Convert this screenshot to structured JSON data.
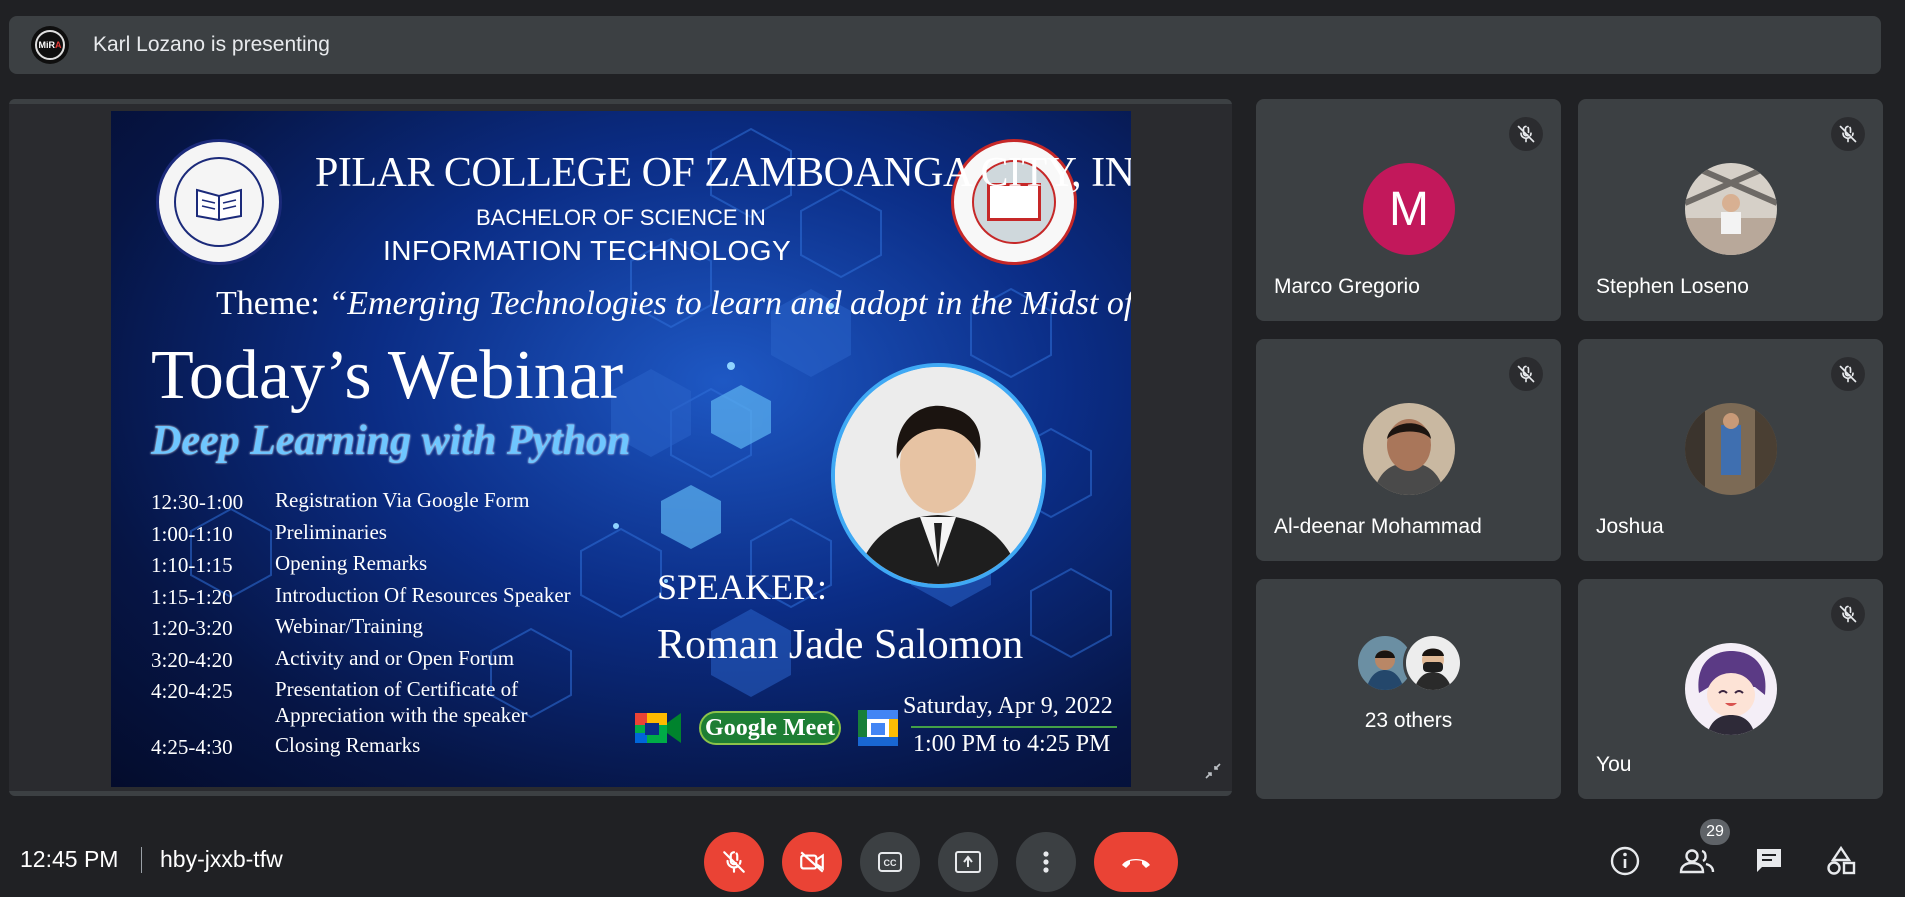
{
  "presenter_bar": {
    "avatar_text_main": "MiR",
    "avatar_text_accent": "A",
    "text": "Karl Lozano is presenting"
  },
  "slide": {
    "college": "PILAR COLLEGE OF ZAMBOANGA CITY, INC.",
    "degree_line1": "BACHELOR OF SCIENCE IN",
    "degree_line2": "INFORMATION TECHNOLOGY",
    "theme_label": "Theme:",
    "theme_text": "“Emerging Technologies to learn and adopt in the Midst of Pandemic”",
    "heading": "Today’s Webinar",
    "subheading": "Deep Learning with Python",
    "schedule": [
      {
        "time": "12:30-1:00",
        "activity": "Registration Via Google Form"
      },
      {
        "time": "1:00-1:10",
        "activity": "Preliminaries"
      },
      {
        "time": "1:10-1:15",
        "activity": "Opening Remarks"
      },
      {
        "time": "1:15-1:20",
        "activity": "Introduction Of Resources Speaker"
      },
      {
        "time": "1:20-3:20",
        "activity": "Webinar/Training"
      },
      {
        "time": "3:20-4:20",
        "activity": "Activity and or Open Forum"
      },
      {
        "time": "4:20-4:25",
        "activity": "Presentation of Certificate of Appreciation with the speaker"
      },
      {
        "time": "4:25-4:30",
        "activity": "Closing Remarks"
      }
    ],
    "speaker_label": "SPEAKER:",
    "speaker_name": "Roman Jade Salomon",
    "platform": "Google Meet",
    "date": "Saturday, Apr 9, 2022",
    "time": "1:00 PM to 4:25 PM"
  },
  "participants": [
    {
      "name": "Marco Gregorio",
      "initial": "M",
      "muted": true
    },
    {
      "name": "Stephen Loseno",
      "muted": true
    },
    {
      "name": "Al-deenar Mohammad",
      "muted": true
    },
    {
      "name": "Joshua",
      "muted": true
    }
  ],
  "others": {
    "label": "23 others"
  },
  "self": {
    "name": "You",
    "muted": true
  },
  "bottom_bar": {
    "time": "12:45 PM",
    "meeting_code": "hby-jxxb-tfw",
    "people_count": "29"
  },
  "colors": {
    "background": "#202124",
    "tile": "#3c4043",
    "danger": "#ea4335",
    "avatar_m": "#c2185b"
  },
  "icons": [
    "mic-off-icon",
    "video-off-icon",
    "captions-icon",
    "present-icon",
    "more-vert-icon",
    "call-end-icon",
    "info-icon",
    "people-icon",
    "chat-icon",
    "activities-icon",
    "collapse-icon"
  ]
}
